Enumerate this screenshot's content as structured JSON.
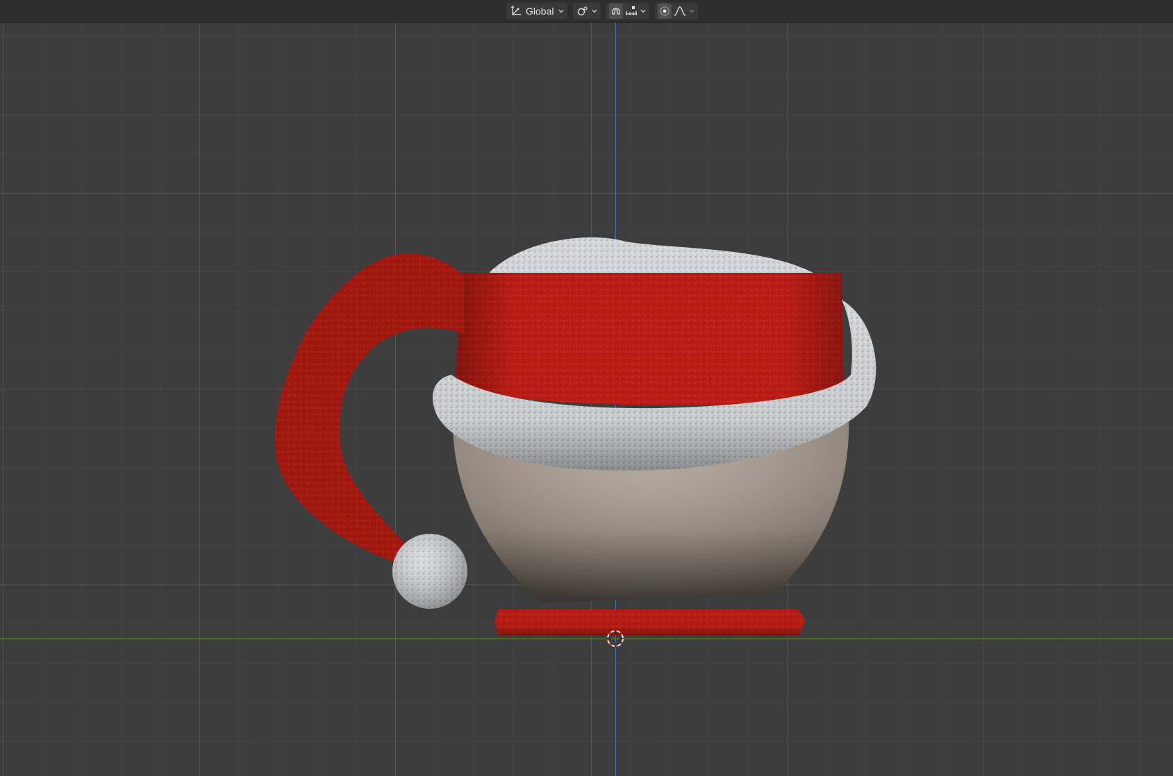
{
  "header": {
    "transform_orientation": {
      "icon": "orientation-axes-icon",
      "label": "Global"
    },
    "pivot": {
      "icon": "pivot-point-icon"
    },
    "snapping": {
      "toggle_icon": "snap-magnet-icon",
      "toggle_active": true,
      "snap_target_icon": "snap-increment-icon"
    },
    "proportional_editing": {
      "toggle_icon": "proportional-edit-icon",
      "falloff_icon": "falloff-curve-icon"
    }
  },
  "scene": {
    "object": "santa-hat-mug",
    "colors": {
      "hat_red": "#b81c14",
      "fur_white": "#d8d8d8",
      "mug_beige": "#a3958a",
      "saucer_red": "#b31a14"
    }
  },
  "viewport": {
    "background": "#3d3d3d",
    "axis_z_color": "#3f6bbd",
    "axis_y_color": "#6a9a36"
  }
}
